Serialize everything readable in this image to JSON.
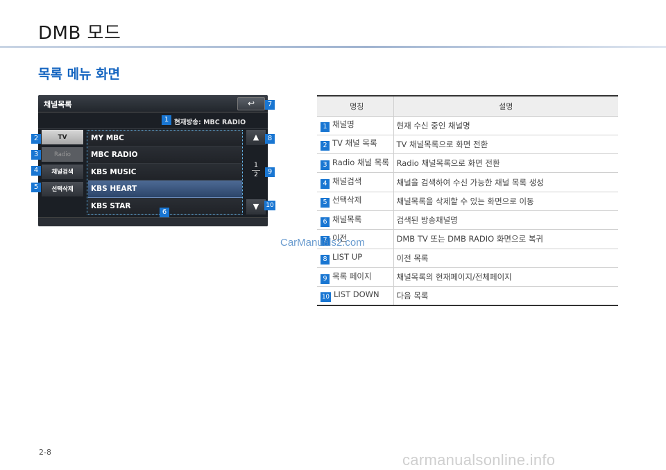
{
  "header": {
    "title": "DMB 모드"
  },
  "section": {
    "title": "목록 메뉴 화면"
  },
  "screen": {
    "title": "채널목록",
    "back_icon": "↩",
    "current_broadcast": "현재방송: MBC RADIO",
    "side_menu": [
      "TV",
      "Radio",
      "채널검색",
      "선택삭제"
    ],
    "channels": [
      "MY MBC",
      "MBC RADIO",
      "KBS MUSIC",
      "KBS HEART",
      "KBS STAR"
    ],
    "selected_channel_index": 3,
    "scroll_up_icon": "▲",
    "scroll_down_icon": "▼",
    "page_current": "1",
    "page_total": "2"
  },
  "markers": [
    "1",
    "2",
    "3",
    "4",
    "5",
    "6",
    "7",
    "8",
    "9",
    "10"
  ],
  "table": {
    "headers": [
      "명칭",
      "설명"
    ],
    "rows": [
      {
        "num": "1",
        "name": "채널명",
        "desc": "현재 수신 중인 채널명"
      },
      {
        "num": "2",
        "name": "TV 채널 목록",
        "desc": "TV 채널목록으로 화면 전환"
      },
      {
        "num": "3",
        "name": "Radio 채널 목록",
        "desc": "Radio 채널목록으로 화면 전환"
      },
      {
        "num": "4",
        "name": "채널검색",
        "desc": "채널을 검색하여 수신 가능한 채널 목록 생성"
      },
      {
        "num": "5",
        "name": "선택삭제",
        "desc": "채널목록을 삭제할 수 있는 화면으로 이동"
      },
      {
        "num": "6",
        "name": "채널목록",
        "desc": "검색된 방송채널명"
      },
      {
        "num": "7",
        "name": "이전",
        "desc": "DMB TV 또는 DMB RADIO 화면으로 복귀"
      },
      {
        "num": "8",
        "name": "LIST UP",
        "desc": "이전 목록"
      },
      {
        "num": "9",
        "name": "목록 페이지",
        "desc": "채널목록의 현재페이지/전체페이지"
      },
      {
        "num": "10",
        "name": "LIST DOWN",
        "desc": "다음 목록"
      }
    ]
  },
  "watermark": "CarManuals2.com",
  "page_number": "2-8",
  "footer_site": "carmanualsonline.info",
  "colors": {
    "accent": "#1976d2",
    "title_blue": "#1565c0"
  }
}
